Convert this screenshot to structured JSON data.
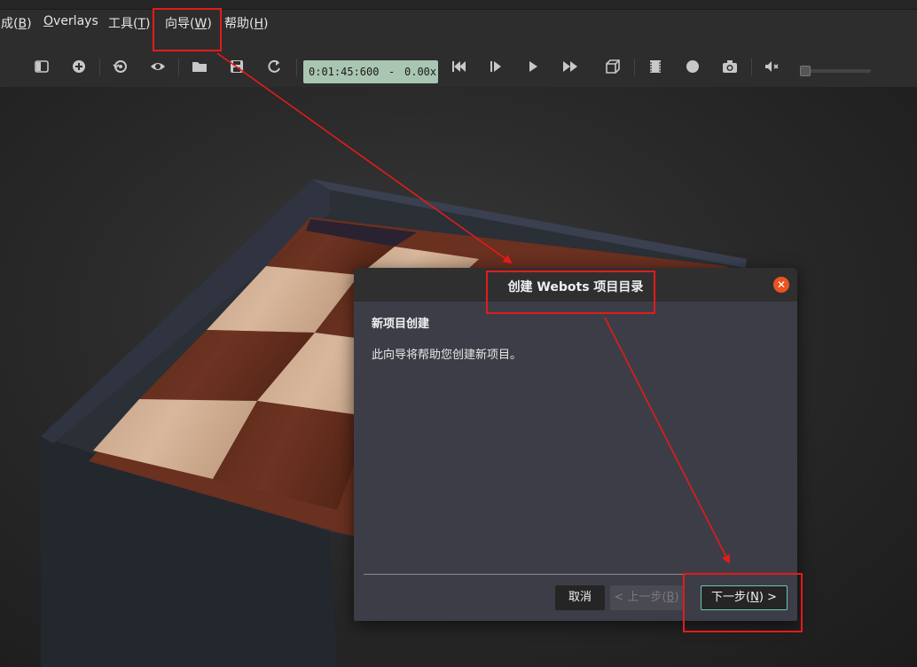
{
  "menu": {
    "items": [
      {
        "pre": "成(",
        "mnemonic": "B",
        "post": ")"
      },
      {
        "pre": "",
        "mnemonic": "O",
        "post": "verlays"
      },
      {
        "pre": "工具(",
        "mnemonic": "T",
        "post": ")"
      },
      {
        "pre": "向导(",
        "mnemonic": "W",
        "post": ")"
      },
      {
        "pre": "帮助(",
        "mnemonic": "H",
        "post": ")"
      }
    ]
  },
  "toolbar": {
    "time": "0:01:45:600",
    "time_separator": "-",
    "speed": "0.00x",
    "icons": [
      "toggle-scene-tree-icon",
      "add-node-icon",
      "reset-viewpoint-icon",
      "visibility-icon",
      "open-world-icon",
      "save-world-icon",
      "reload-world-icon",
      "step-back-icon",
      "step-icon",
      "play-icon",
      "fast-forward-icon",
      "3d-view-icon",
      "record-movie-icon",
      "record-animation-icon",
      "screenshot-icon",
      "mute-icon"
    ]
  },
  "dialog": {
    "title": "创建 Webots 项目目录",
    "close_glyph": "✕",
    "heading": "新项目创建",
    "description": "此向导将帮助您创建新项目。",
    "cancel_label": "取消",
    "back_label_pre": "< 上一步(",
    "back_mnemonic": "B",
    "back_label_post": ")",
    "next_label_pre": "下一步(",
    "next_mnemonic": "N",
    "next_label_post": ") >"
  },
  "colors": {
    "annotation_red": "#e21b1b",
    "accent_orange": "#e95420",
    "time_display_bg": "#a9c6b2",
    "next_button_border": "#6ac7b0"
  }
}
